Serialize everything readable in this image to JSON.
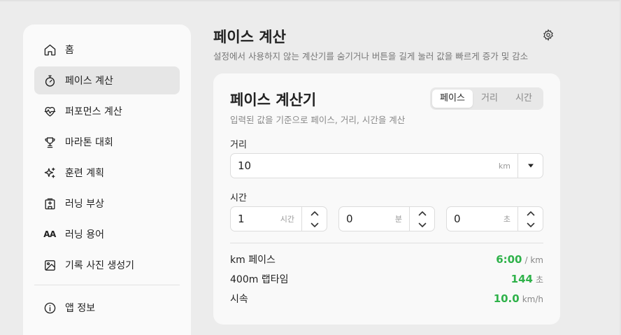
{
  "sidebar": {
    "items": [
      {
        "label": "홈",
        "icon": "home-icon"
      },
      {
        "label": "페이스 계산",
        "icon": "stopwatch-icon"
      },
      {
        "label": "퍼포먼스 계산",
        "icon": "heartbeat-icon"
      },
      {
        "label": "마라톤 대회",
        "icon": "trophy-icon"
      },
      {
        "label": "훈련 계획",
        "icon": "sparkles-icon"
      },
      {
        "label": "러닝 부상",
        "icon": "hospital-icon"
      },
      {
        "label": "러닝 용어",
        "icon": "text-aa-icon",
        "icon_text": "AA"
      },
      {
        "label": "기록 사진 생성기",
        "icon": "image-icon"
      }
    ],
    "footer_items": [
      {
        "label": "앱 정보",
        "icon": "info-icon"
      }
    ],
    "active_index": 1
  },
  "header": {
    "title": "페이스 계산",
    "description": "설정에서 사용하지 않는 계산기를 숨기거나 버튼을 길게 눌러 값을 빠르게 증가 및 감소"
  },
  "calculator": {
    "title": "페이스 계산기",
    "subtitle": "입력된 값을 기준으로 페이스, 거리, 시간을 계산",
    "mode_tabs": [
      "페이스",
      "거리",
      "시간"
    ],
    "selected_mode": "페이스",
    "distance": {
      "label": "거리",
      "value": "10",
      "unit": "km"
    },
    "time": {
      "label": "시간",
      "hours": {
        "value": "1",
        "unit": "시간"
      },
      "minutes": {
        "value": "0",
        "unit": "분"
      },
      "seconds": {
        "value": "0",
        "unit": "초"
      }
    },
    "results": [
      {
        "label": "km 페이스",
        "value": "6:00",
        "unit": "/ km"
      },
      {
        "label": "400m 랩타임",
        "value": "144",
        "unit": "초"
      },
      {
        "label": "시속",
        "value": "10.0",
        "unit": "km/h"
      }
    ]
  },
  "colors": {
    "accent_green": "#2fb24a",
    "active_nav_bg": "#e6e6e6"
  }
}
